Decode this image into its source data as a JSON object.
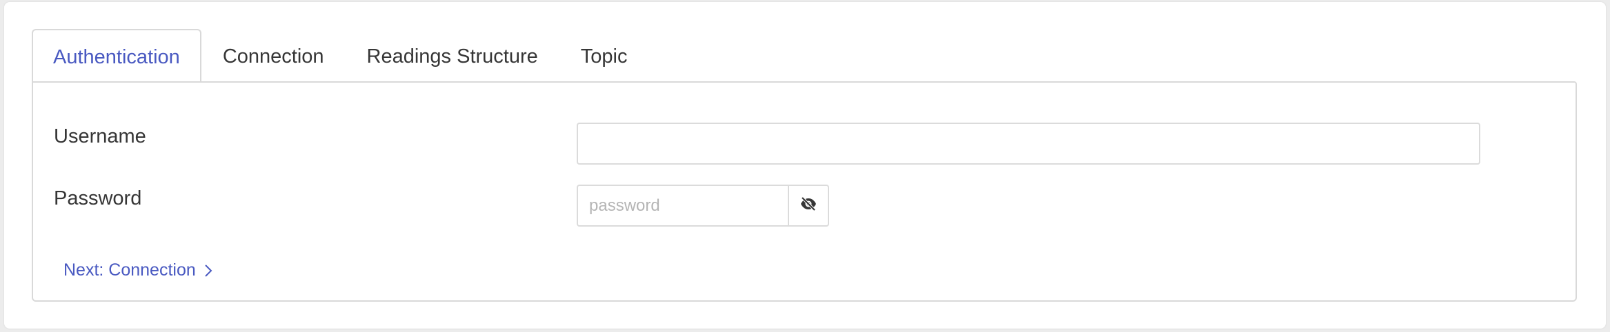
{
  "tabs": [
    {
      "label": "Authentication",
      "active": true
    },
    {
      "label": "Connection",
      "active": false
    },
    {
      "label": "Readings Structure",
      "active": false
    },
    {
      "label": "Topic",
      "active": false
    }
  ],
  "form": {
    "username_label": "Username",
    "username_value": "",
    "password_label": "Password",
    "password_placeholder": "password",
    "password_toggle_icon": "eye-slash-icon"
  },
  "next": {
    "label": "Next: Connection",
    "icon": "chevron-right-icon"
  },
  "colors": {
    "accent": "#4959c1",
    "text": "#363636",
    "border": "#d9d9d9",
    "placeholder": "#b5b5b5"
  }
}
